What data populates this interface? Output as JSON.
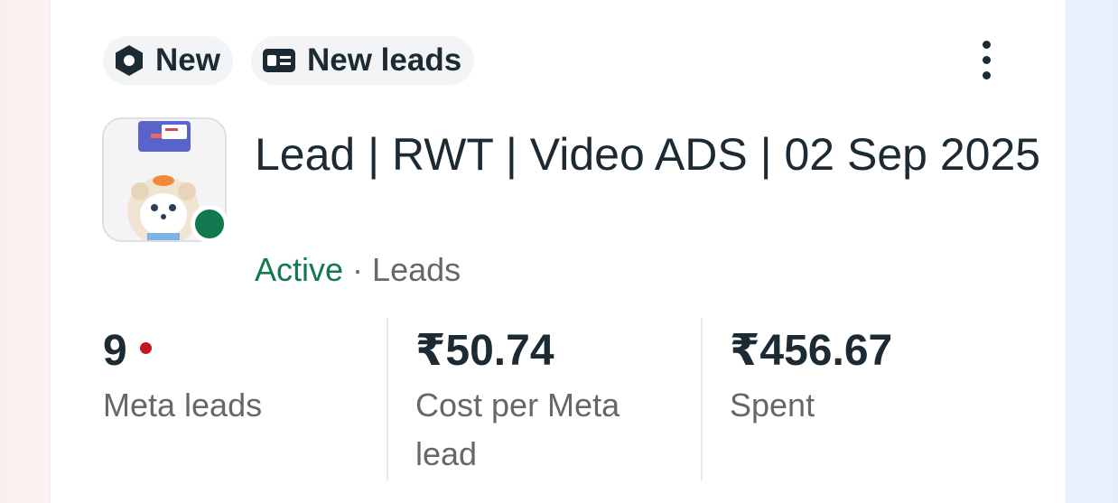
{
  "tags": [
    {
      "icon": "hexagon-icon",
      "label": "New"
    },
    {
      "icon": "lead-form-icon",
      "label": "New leads"
    }
  ],
  "campaign": {
    "title": "Lead | RWT | Video ADS | 02 Sep 2025",
    "status": "Active",
    "separator": "·",
    "objective": "Leads",
    "status_color": "#12784f"
  },
  "metrics": [
    {
      "value": "9",
      "label": "Meta leads",
      "indicator_color": "#c4161c"
    },
    {
      "value": "₹50.74",
      "label": "Cost per Meta lead"
    },
    {
      "value": "₹456.67",
      "label": "Spent"
    }
  ],
  "colors": {
    "text_primary": "#1c2b33",
    "text_secondary": "#65676b",
    "tag_bg": "#f3f4f6"
  }
}
